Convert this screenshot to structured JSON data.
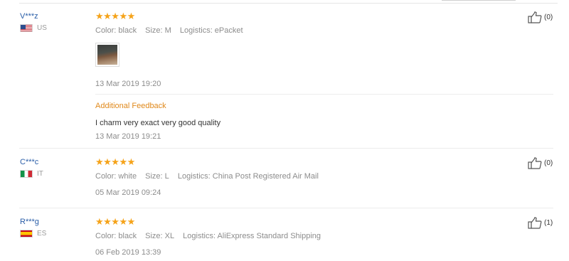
{
  "reviews": [
    {
      "user": "V***z",
      "country": "US",
      "flag_color": "#2c4e8f",
      "stars": "★★★★★",
      "attrs": [
        "Color: black",
        "Size: M",
        "Logistics: ePacket"
      ],
      "date": "13 Mar 2019 19:20",
      "feedback_title": "Additional Feedback",
      "feedback_text": "I charm very exact very good quality",
      "feedback_date": "13 Mar 2019 19:21",
      "likes": "(0)"
    },
    {
      "user": "C***c",
      "country": "IT",
      "stars": "★★★★★",
      "attrs": [
        "Color: white",
        "Size: L",
        "Logistics: China Post Registered Air Mail"
      ],
      "date": "05 Mar 2019 09:24",
      "likes": "(0)"
    },
    {
      "user": "R***g",
      "country": "ES",
      "stars": "★★★★★",
      "attrs": [
        "Color: black",
        "Size: XL",
        "Logistics: AliExpress Standard Shipping"
      ],
      "date": "06 Feb 2019 13:39",
      "likes": "(1)"
    }
  ],
  "colors": {
    "star": "#f5a31a",
    "user_link": "#2a5ea8",
    "feedback_title": "#e0891b"
  },
  "icons": {
    "like": "thumbs-up-icon"
  }
}
